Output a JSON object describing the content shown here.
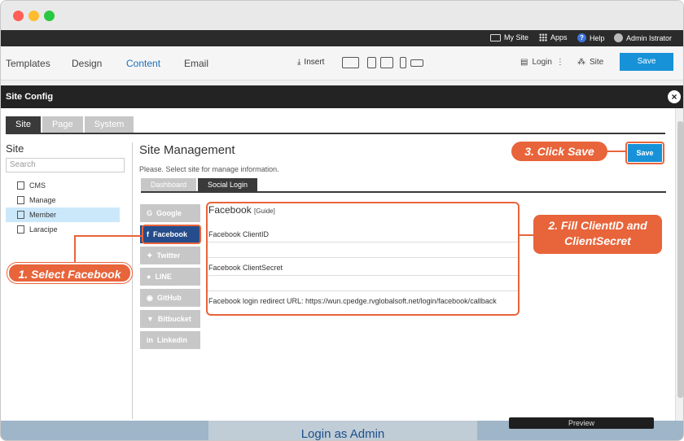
{
  "topbar": {
    "my_site": "My Site",
    "apps": "Apps",
    "help": "Help",
    "user": "Admin Istrator"
  },
  "editor": {
    "nav": [
      "Templates",
      "Design",
      "Content",
      "Email"
    ],
    "active_nav": "Content",
    "insert": "Insert",
    "login": "Login",
    "site": "Site",
    "save": "Save"
  },
  "modal": {
    "title": "Site Config",
    "tabs": [
      "Site",
      "Page",
      "System"
    ]
  },
  "site_panel": {
    "label": "Site",
    "search_placeholder": "Search",
    "tree": [
      "CMS",
      "Manage",
      "Member",
      "Laracipe"
    ]
  },
  "management": {
    "title": "Site Management",
    "subtitle": "Please. Select site for manage information.",
    "save": "Save",
    "subtabs": [
      "Dashboard",
      "Social Login"
    ]
  },
  "providers": [
    "Google",
    "Facebook",
    "Twitter",
    "LINE",
    "GitHub",
    "Bitbucket",
    "Linkedin"
  ],
  "facebook": {
    "title": "Facebook",
    "guide": "[Guide]",
    "client_id_label": "Facebook ClientID",
    "client_secret_label": "Facebook ClientSecret",
    "redirect_label": "Facebook login redirect URL: https://wun.cpedge.rvglobalsoft.net/login/facebook/callback"
  },
  "callouts": {
    "step1": "1. Select  Facebook",
    "step2_line1": "2. Fill ClientID and",
    "step2_line2": "ClientSecret",
    "step3": "3. Click Save"
  },
  "bottom": {
    "login_as_admin": "Login as Admin",
    "preview": "Preview"
  },
  "colors": {
    "accent": "#e8643a",
    "primary": "#1792d8",
    "active_provider": "#264c8b"
  }
}
